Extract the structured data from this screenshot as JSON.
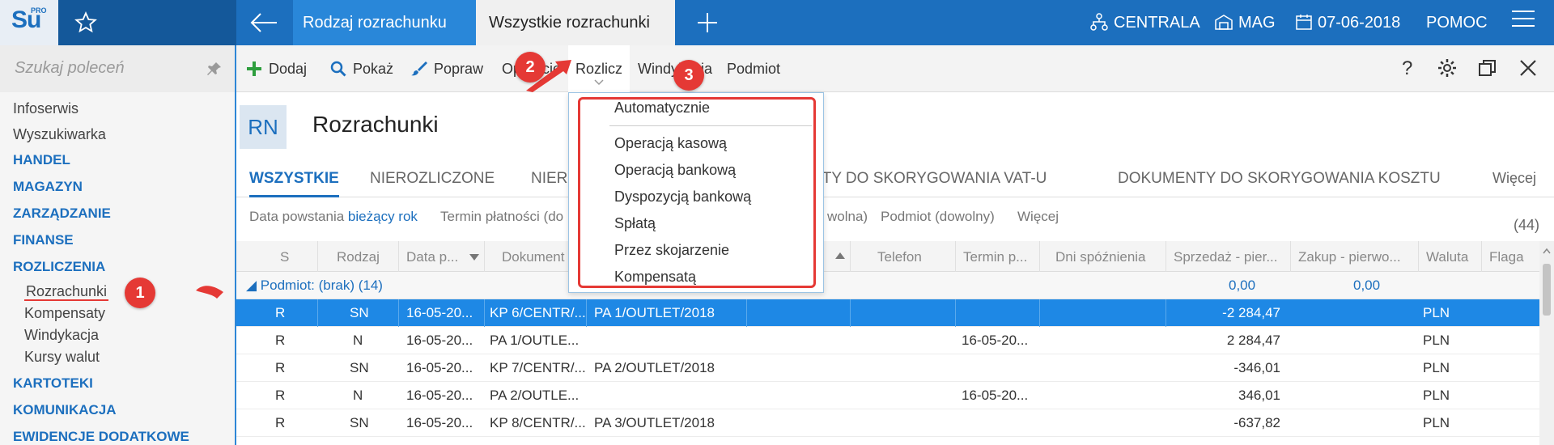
{
  "app": {
    "logo_text": "Su",
    "logo_sup": "PRO"
  },
  "tabs": [
    {
      "label": "Rodzaj rozrachunku"
    },
    {
      "label": "Wszystkie rozrachunki"
    }
  ],
  "topbar_right": {
    "centrala": "CENTRALA",
    "mag": "MAG",
    "date": "07-06-2018",
    "pomoc": "POMOC"
  },
  "sidebar": {
    "search_placeholder": "Szukaj poleceń",
    "items": [
      "Infoserwis",
      "Wyszukiwarka"
    ],
    "sections": [
      "HANDEL",
      "MAGAZYN",
      "ZARZĄDZANIE",
      "FINANSE",
      "ROZLICZENIA",
      "KARTOTEKI",
      "KOMUNIKACJA",
      "EWIDENCJE DODATKOWE"
    ],
    "subitems": [
      "Rozrachunki",
      "Kompensaty",
      "Windykacja",
      "Kursy walut"
    ]
  },
  "toolbar": {
    "dodaj": "Dodaj",
    "pokaz": "Pokaż",
    "popraw": "Popraw",
    "operacje": "Operacje",
    "rozlicz": "Rozlicz",
    "windykacja": "Windykacja",
    "podmiot": "Podmiot",
    "help": "?"
  },
  "header": {
    "badge": "RN",
    "title": "Rozrachunki"
  },
  "filter_tabs": [
    "WSZYSTKIE",
    "NIEROZLICZONE",
    "NIER",
    "NTY DO SKORYGOWANIA VAT-U",
    "DOKUMENTY DO SKORYGOWANIA KOSZTU",
    "Więcej"
  ],
  "filters": {
    "data_label": "Data powstania",
    "data_value": "bieżący rok",
    "termin": "Termin płatności (do",
    "dowolna": "wolna)",
    "podmiot": "Podmiot (dowolny)",
    "wiecej": "Więcej",
    "count": "(44)"
  },
  "table": {
    "headers": [
      "S",
      "Rodzaj",
      "Data p...",
      "Dokument",
      "Telefon",
      "Termin p...",
      "Dni spóźnienia",
      "Sprzedaż - pier...",
      "Zakup - pierwo...",
      "Waluta",
      "Flaga"
    ],
    "group": {
      "label": "Podmiot: (brak) (14)",
      "sprzedaz": "0,00",
      "zakup": "0,00"
    },
    "rows": [
      {
        "s": "R",
        "rodzaj": "SN",
        "data": "16-05-20...",
        "dok": "KP 6/CENTR/...",
        "dok2": "PA 1/OUTLET/2018",
        "termin": "",
        "kwota": "-2 284,47",
        "waluta": "PLN",
        "selected": true
      },
      {
        "s": "R",
        "rodzaj": "N",
        "data": "16-05-20...",
        "dok": "PA 1/OUTLE...",
        "dok2": "",
        "termin": "16-05-20...",
        "kwota": "2 284,47",
        "waluta": "PLN",
        "selected": false
      },
      {
        "s": "R",
        "rodzaj": "SN",
        "data": "16-05-20...",
        "dok": "KP 7/CENTR/...",
        "dok2": "PA 2/OUTLET/2018",
        "termin": "",
        "kwota": "-346,01",
        "waluta": "PLN",
        "selected": false
      },
      {
        "s": "R",
        "rodzaj": "N",
        "data": "16-05-20...",
        "dok": "PA 2/OUTLE...",
        "dok2": "",
        "termin": "16-05-20...",
        "kwota": "346,01",
        "waluta": "PLN",
        "selected": false
      },
      {
        "s": "R",
        "rodzaj": "SN",
        "data": "16-05-20...",
        "dok": "KP 8/CENTR/...",
        "dok2": "PA 3/OUTLET/2018",
        "termin": "",
        "kwota": "-637,82",
        "waluta": "PLN",
        "selected": false
      }
    ]
  },
  "dropdown": {
    "items": [
      "Automatycznie",
      "Operacją kasową",
      "Operacją bankową",
      "Dyspozycją bankową",
      "Spłatą",
      "Przez skojarzenie",
      "Kompensatą"
    ]
  },
  "annotations": {
    "b1": "1",
    "b2": "2",
    "b3": "3"
  },
  "colors": {
    "primary": "#1c6fbe",
    "highlight": "#e53935",
    "selected_row": "#1e88e5"
  }
}
